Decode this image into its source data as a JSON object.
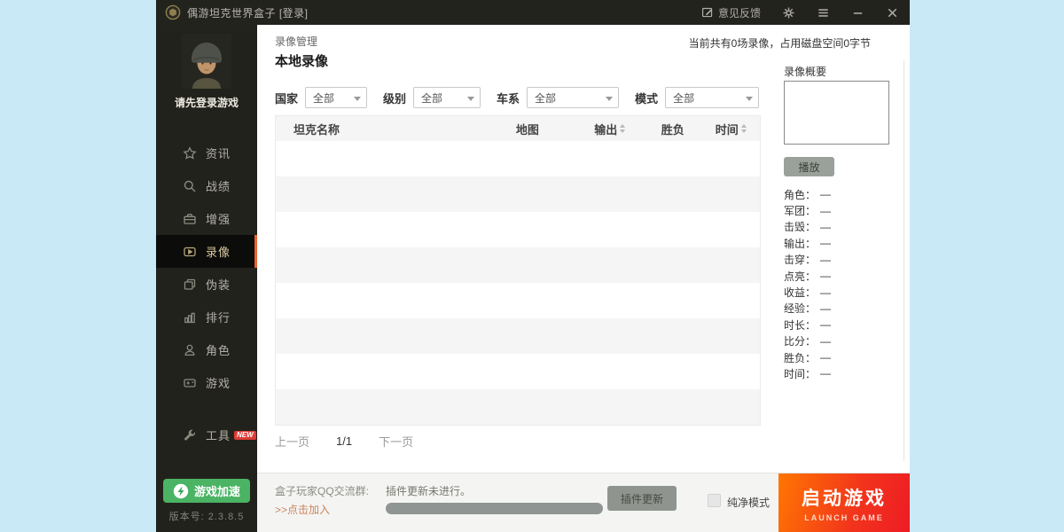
{
  "titlebar": {
    "app_title": "偶游坦克世界盒子 [登录]",
    "feedback_label": "意见反馈"
  },
  "sidebar": {
    "login_hint": "请先登录游戏",
    "items": [
      {
        "label": "资讯",
        "icon": "star-icon"
      },
      {
        "label": "战绩",
        "icon": "search-icon"
      },
      {
        "label": "增强",
        "icon": "briefcase-icon"
      },
      {
        "label": "录像",
        "icon": "video-icon",
        "selected": true
      },
      {
        "label": "伪装",
        "icon": "layers-icon"
      },
      {
        "label": "排行",
        "icon": "bar-chart-icon"
      },
      {
        "label": "角色",
        "icon": "person-icon"
      },
      {
        "label": "游戏",
        "icon": "game-card-icon"
      }
    ],
    "tools": {
      "label": "工具",
      "badge": "NEW"
    },
    "boost_button_label": "游戏加速",
    "version_text": "版本号: 2.3.8.5"
  },
  "main": {
    "breadcrumb": "录像管理",
    "page_title": "本地录像",
    "storage_info": "当前共有0场录像，占用磁盘空间0字节",
    "filters": [
      {
        "label": "国家",
        "value": "全部"
      },
      {
        "label": "级别",
        "value": "全部"
      },
      {
        "label": "车系",
        "value": "全部"
      },
      {
        "label": "模式",
        "value": "全部"
      }
    ],
    "table": {
      "columns": [
        {
          "label": "坦克名称",
          "sortable": false
        },
        {
          "label": "地图",
          "sortable": false
        },
        {
          "label": "输出",
          "sortable": true
        },
        {
          "label": "胜负",
          "sortable": false
        },
        {
          "label": "时间",
          "sortable": true
        }
      ],
      "rows": [],
      "empty_row_count": 8
    },
    "pagination": {
      "prev": "上一页",
      "page": "1/1",
      "next": "下一页"
    }
  },
  "summary": {
    "title": "录像概要",
    "play_button": "播放",
    "stats": [
      {
        "label": "角色：",
        "value": "—"
      },
      {
        "label": "军团：",
        "value": "—"
      },
      {
        "label": "击毁：",
        "value": "—"
      },
      {
        "label": "输出：",
        "value": "—"
      },
      {
        "label": "击穿：",
        "value": "—"
      },
      {
        "label": "点亮：",
        "value": "—"
      },
      {
        "label": "收益：",
        "value": "—"
      },
      {
        "label": "经验：",
        "value": "—"
      },
      {
        "label": "时长：",
        "value": "—"
      },
      {
        "label": "比分：",
        "value": "—"
      },
      {
        "label": "胜负：",
        "value": "—"
      },
      {
        "label": "时间：",
        "value": "—"
      }
    ]
  },
  "footer": {
    "qq_group_label": "盒子玩家QQ交流群:",
    "qq_join_link": ">>点击加入",
    "plugin_status": "插件更新未进行。",
    "plugin_update_button": "插件更新",
    "pure_mode_label": "纯净模式",
    "pure_mode_checked": false,
    "launch_button": {
      "title": "启动游戏",
      "subtitle": "LAUNCH GAME"
    }
  },
  "colors": {
    "selected_accent": "#e8642c",
    "launch_gradient_start": "#ff7602",
    "launch_gradient_end": "#ee1c25",
    "boost_green": "#4ab364",
    "new_badge_red": "#dd3b35",
    "desktop_background": "#c9e9f7",
    "titlebar_background": "#23231e",
    "sidebar_background": "#22221c"
  }
}
